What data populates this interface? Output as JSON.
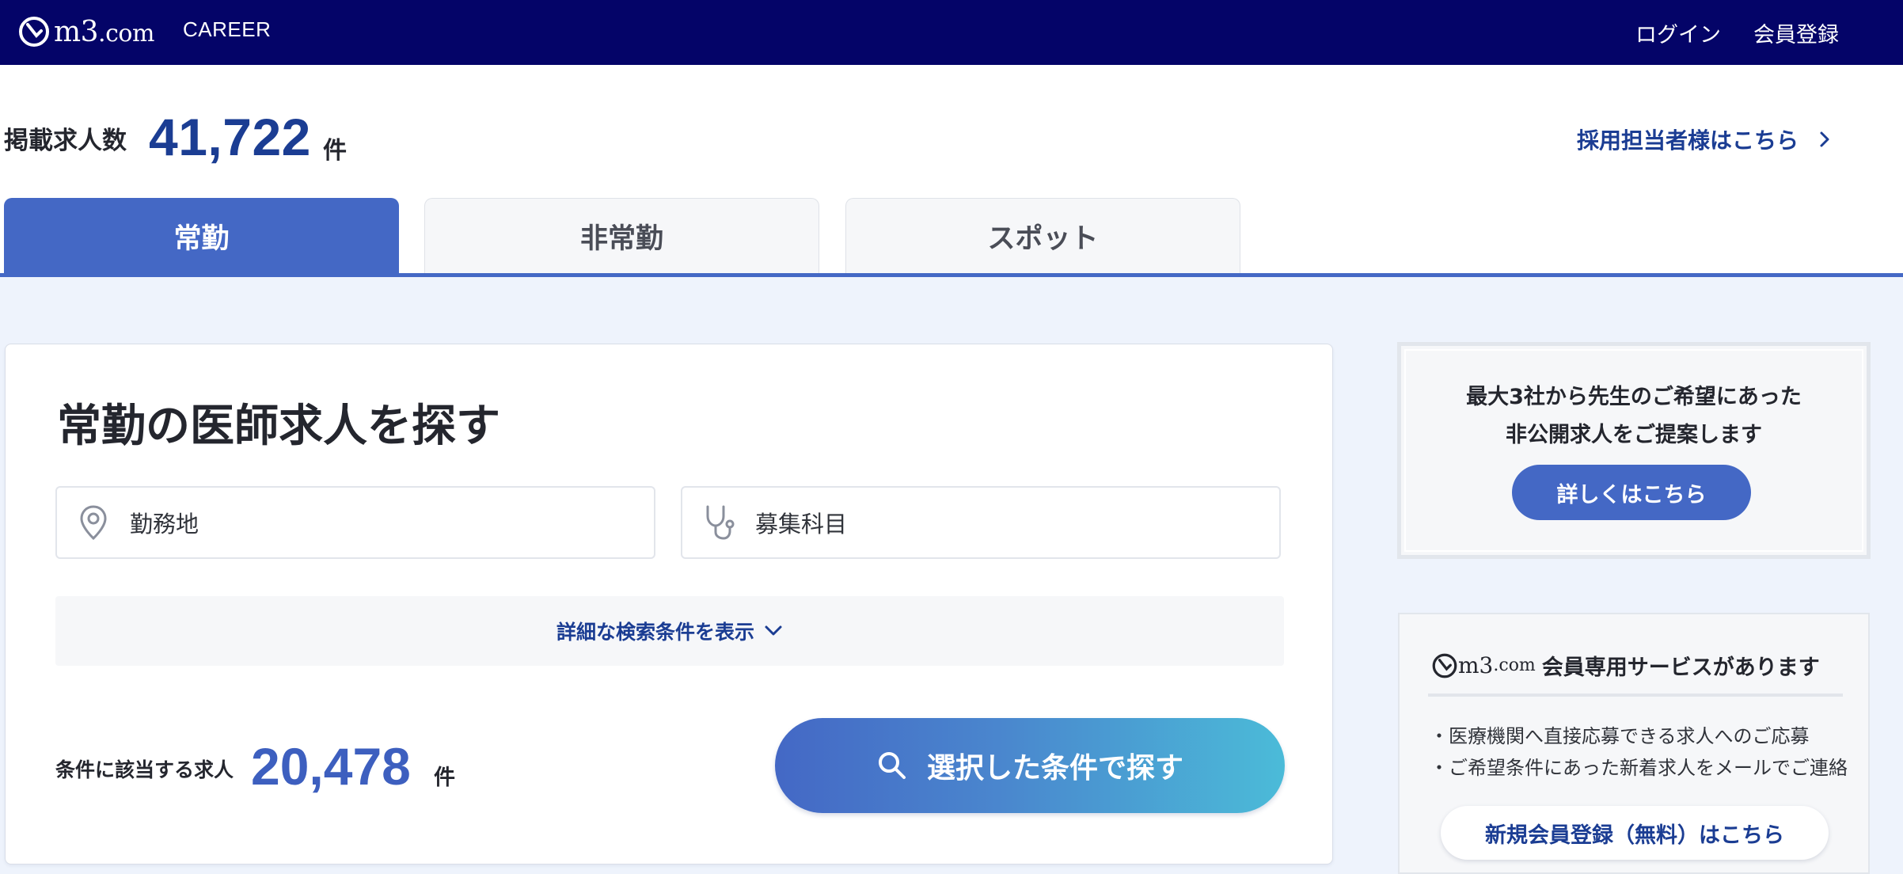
{
  "header": {
    "logo_text": "m3",
    "logo_suffix": ".com",
    "sub_brand": "CAREER",
    "login_label": "ログイン",
    "register_label": "会員登録"
  },
  "summary": {
    "count_label": "掲載求人数",
    "count": "41,722",
    "count_unit": "件",
    "recruiter_link": "採用担当者様はこちら"
  },
  "tabs": [
    {
      "label": "常勤",
      "active": true
    },
    {
      "label": "非常勤",
      "active": false
    },
    {
      "label": "スポット",
      "active": false
    }
  ],
  "search": {
    "title": "常勤の医師求人を探す",
    "location_field": {
      "value": "勤務地",
      "icon": "map-pin-icon"
    },
    "specialty_field": {
      "value": "募集科目",
      "icon": "stethoscope-icon"
    },
    "detail_toggle": "詳細な検索条件を表示",
    "match_label": "条件に該当する求人",
    "match_count": "20,478",
    "match_unit": "件",
    "submit_label": "選択した条件で探す"
  },
  "promo": {
    "line1": "最大3社から先生のご希望にあった",
    "line2": "非公開求人をご提案します",
    "button": "詳しくはこちら"
  },
  "member": {
    "logo_text": "m3",
    "logo_suffix": ".com",
    "title": "会員専用サービスがあります",
    "items": [
      "・医療機関へ直接応募できる求人へのご応募",
      "・ご希望条件にあった新着求人をメールでご連絡"
    ],
    "button": "新規会員登録（無料）はこちら"
  },
  "colors": {
    "header_bg": "#040468",
    "accent": "#4468c5",
    "link": "#1b3d93",
    "page_bg": "#eef3fc"
  }
}
